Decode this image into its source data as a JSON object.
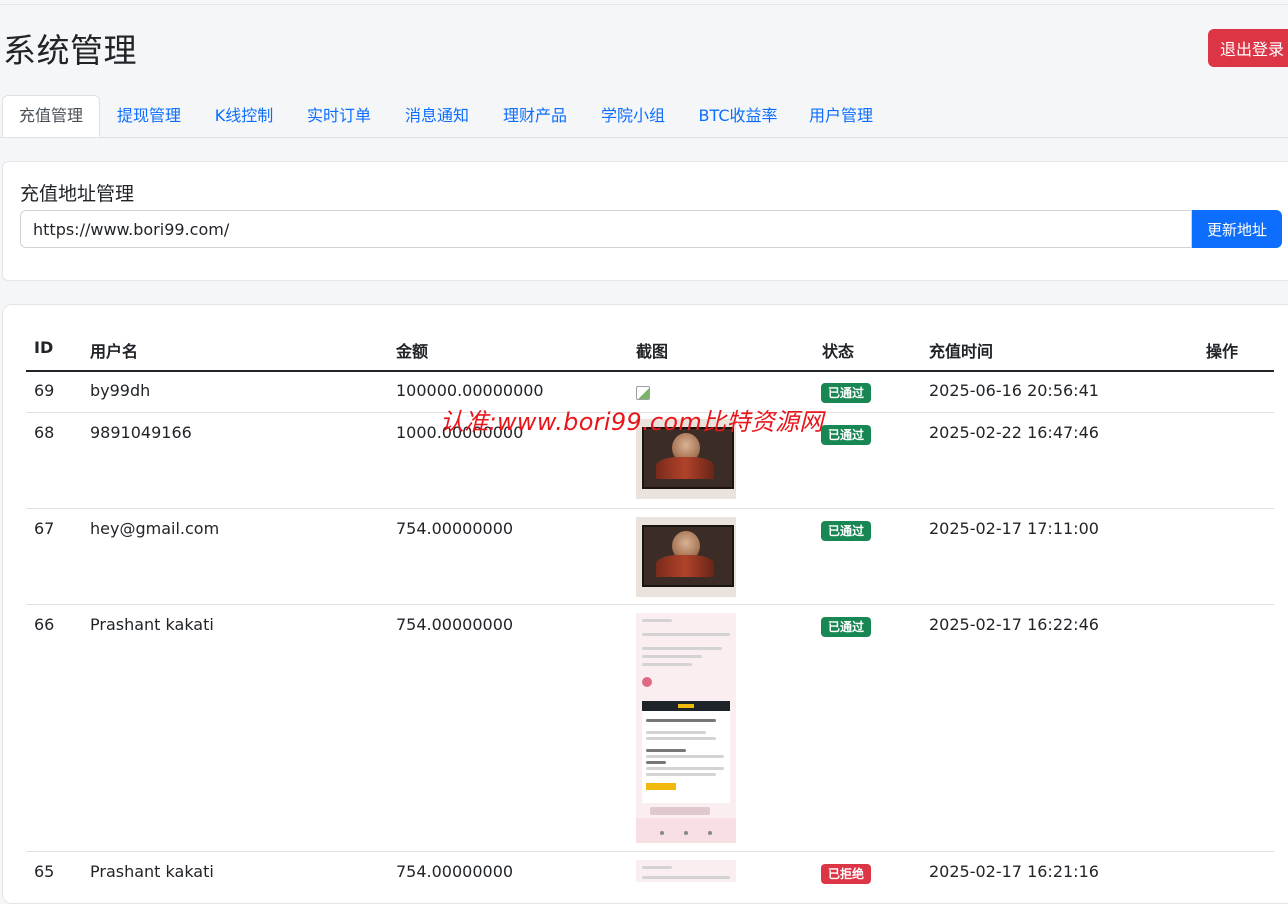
{
  "header": {
    "title": "系统管理",
    "logout_label": "退出登录"
  },
  "tabs": [
    {
      "label": "充值管理",
      "active": true
    },
    {
      "label": "提现管理",
      "active": false
    },
    {
      "label": "K线控制",
      "active": false
    },
    {
      "label": "实时订单",
      "active": false
    },
    {
      "label": "消息通知",
      "active": false
    },
    {
      "label": "理财产品",
      "active": false
    },
    {
      "label": "学院小组",
      "active": false
    },
    {
      "label": "BTC收益率",
      "active": false
    },
    {
      "label": "用户管理",
      "active": false
    }
  ],
  "address_card": {
    "title": "充值地址管理",
    "address_value": "https://www.bori99.com/",
    "update_label": "更新地址"
  },
  "table": {
    "headers": [
      "ID",
      "用户名",
      "金额",
      "截图",
      "状态",
      "充值时间",
      "操作"
    ],
    "rows": [
      {
        "id": "69",
        "username": "by99dh",
        "amount": "100000.00000000",
        "screenshot": "broken-image-icon",
        "status": "已通过",
        "status_type": "approved",
        "time": "2025-06-16 20:56:41"
      },
      {
        "id": "68",
        "username": "9891049166",
        "amount": "1000.00000000",
        "screenshot": "painting-thumbnail",
        "status": "已通过",
        "status_type": "approved",
        "time": "2025-02-22 16:47:46"
      },
      {
        "id": "67",
        "username": "hey@gmail.com",
        "amount": "754.00000000",
        "screenshot": "painting-thumbnail",
        "status": "已通过",
        "status_type": "approved",
        "time": "2025-02-17 17:11:00"
      },
      {
        "id": "66",
        "username": "Prashant kakati",
        "amount": "754.00000000",
        "screenshot": "phone-screenshot-thumbnail",
        "status": "已通过",
        "status_type": "approved",
        "time": "2025-02-17 16:22:46"
      },
      {
        "id": "65",
        "username": "Prashant kakati",
        "amount": "754.00000000",
        "screenshot": "phone-screenshot-thumbnail",
        "status": "已拒绝",
        "status_type": "rejected",
        "time": "2025-02-17 16:21:16"
      }
    ]
  },
  "watermark": "认准:www.bori99.com比特资源网",
  "colors": {
    "primary": "#0d6efd",
    "danger": "#dc3545",
    "success": "#198754"
  }
}
